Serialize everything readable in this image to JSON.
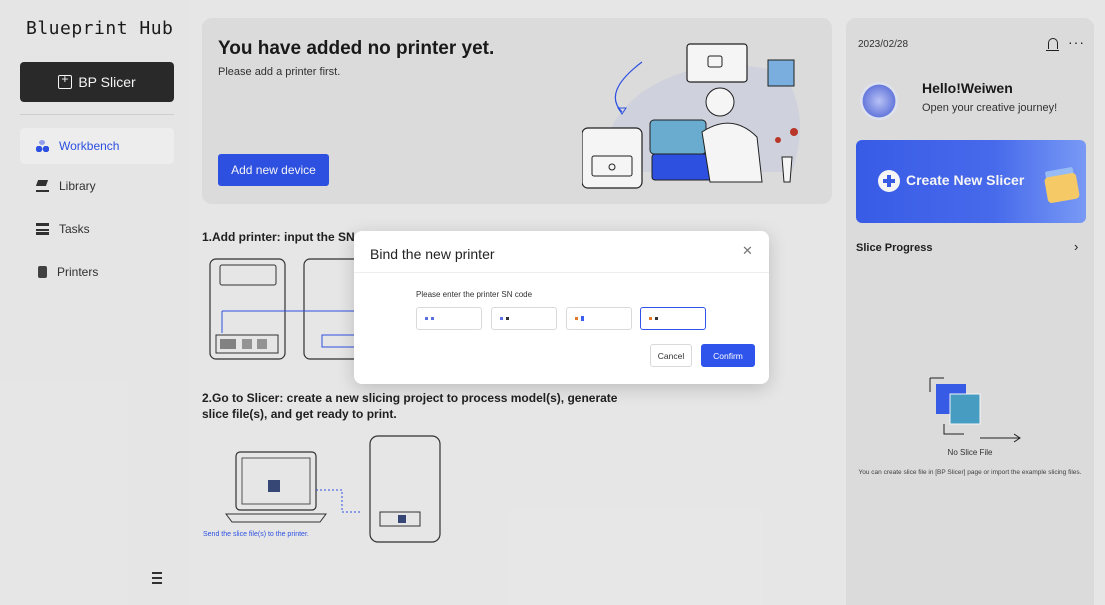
{
  "app": {
    "title": "Blueprint Hub"
  },
  "sidebar": {
    "slicer_button": "BP Slicer",
    "items": [
      {
        "label": "Workbench",
        "icon": "workbench-icon",
        "active": true
      },
      {
        "label": "Library",
        "icon": "library-icon",
        "active": false
      },
      {
        "label": "Tasks",
        "icon": "tasks-icon",
        "active": false
      },
      {
        "label": "Printers",
        "icon": "printers-icon",
        "active": false
      }
    ]
  },
  "banner": {
    "title": "You have added no printer yet.",
    "subtitle": "Please add a printer first.",
    "add_button": "Add new device"
  },
  "steps": {
    "step1": "1.Add printer: input the SN",
    "step2": "2.Go to Slicer: create a new slicing project to process model(s), generate slice file(s), and get ready to print.",
    "send_caption": "Send the slice file(s) to the printer."
  },
  "right_panel": {
    "date": "2023/02/28",
    "greeting": "Hello!Weiwen",
    "tagline": "Open your creative journey!",
    "create_button": "Create New Slicer",
    "slice_progress": "Slice Progress",
    "empty_title": "No Slice File",
    "empty_desc": "You can create slice file in [BP Slicer] page or import the example slicing files."
  },
  "dialog": {
    "title": "Bind the new printer",
    "prompt": "Please enter the printer SN code",
    "cancel": "Cancel",
    "confirm": "Confirm"
  },
  "colors": {
    "accent": "#2f54eb",
    "panel": "#e4e4e4",
    "sidebar_btn": "#2b2b2b"
  }
}
